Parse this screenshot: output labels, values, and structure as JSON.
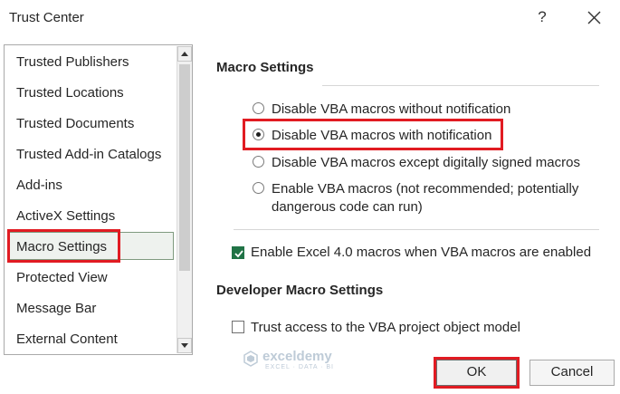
{
  "window": {
    "title": "Trust Center",
    "help_label": "?"
  },
  "sidebar": {
    "items": [
      {
        "label": "Trusted Publishers"
      },
      {
        "label": "Trusted Locations"
      },
      {
        "label": "Trusted Documents"
      },
      {
        "label": "Trusted Add-in Catalogs"
      },
      {
        "label": "Add-ins"
      },
      {
        "label": "ActiveX Settings"
      },
      {
        "label": "Macro Settings",
        "selected": true
      },
      {
        "label": "Protected View"
      },
      {
        "label": "Message Bar"
      },
      {
        "label": "External Content"
      }
    ]
  },
  "macro_settings": {
    "title": "Macro Settings",
    "options": [
      {
        "label": "Disable VBA macros without notification",
        "checked": false
      },
      {
        "label": "Disable VBA macros with notification",
        "checked": true
      },
      {
        "label": "Disable VBA macros except digitally signed macros",
        "checked": false
      },
      {
        "label_line1": "Enable VBA macros (not recommended; potentially",
        "label_line2": "dangerous code can run)",
        "checked": false
      }
    ],
    "excel4_checkbox": {
      "label": "Enable Excel 4.0 macros when VBA macros are enabled",
      "checked": true
    }
  },
  "developer": {
    "title": "Developer Macro Settings",
    "trust_vba_checkbox": {
      "label": "Trust access to the VBA project object model",
      "checked": false
    }
  },
  "buttons": {
    "ok": "OK",
    "cancel": "Cancel"
  },
  "watermark": {
    "name": "exceldemy",
    "tagline": "EXCEL · DATA · BI"
  },
  "colors": {
    "highlight": "#e11b22",
    "accent_green": "#217346"
  }
}
